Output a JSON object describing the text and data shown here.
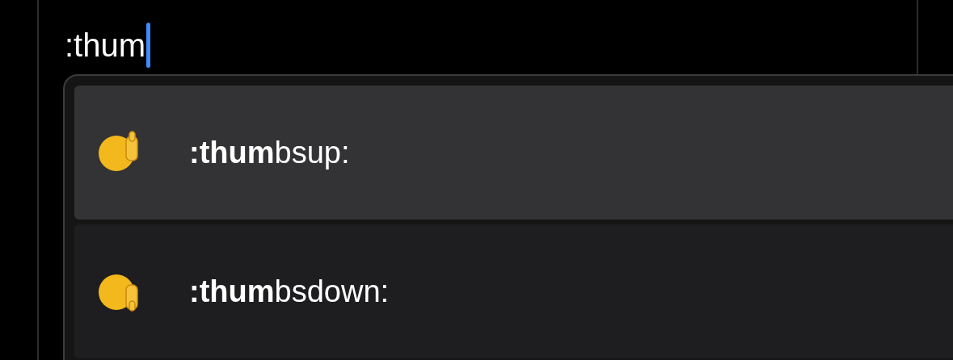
{
  "input": {
    "value": ":thum",
    "focused": true
  },
  "suggestions": [
    {
      "label": "**:thum**bsup:",
      "selected": true,
      "kind": "up"
    },
    {
      "label": "**:thum**bsdown:",
      "selected": false,
      "kind": "down"
    }
  ]
}
